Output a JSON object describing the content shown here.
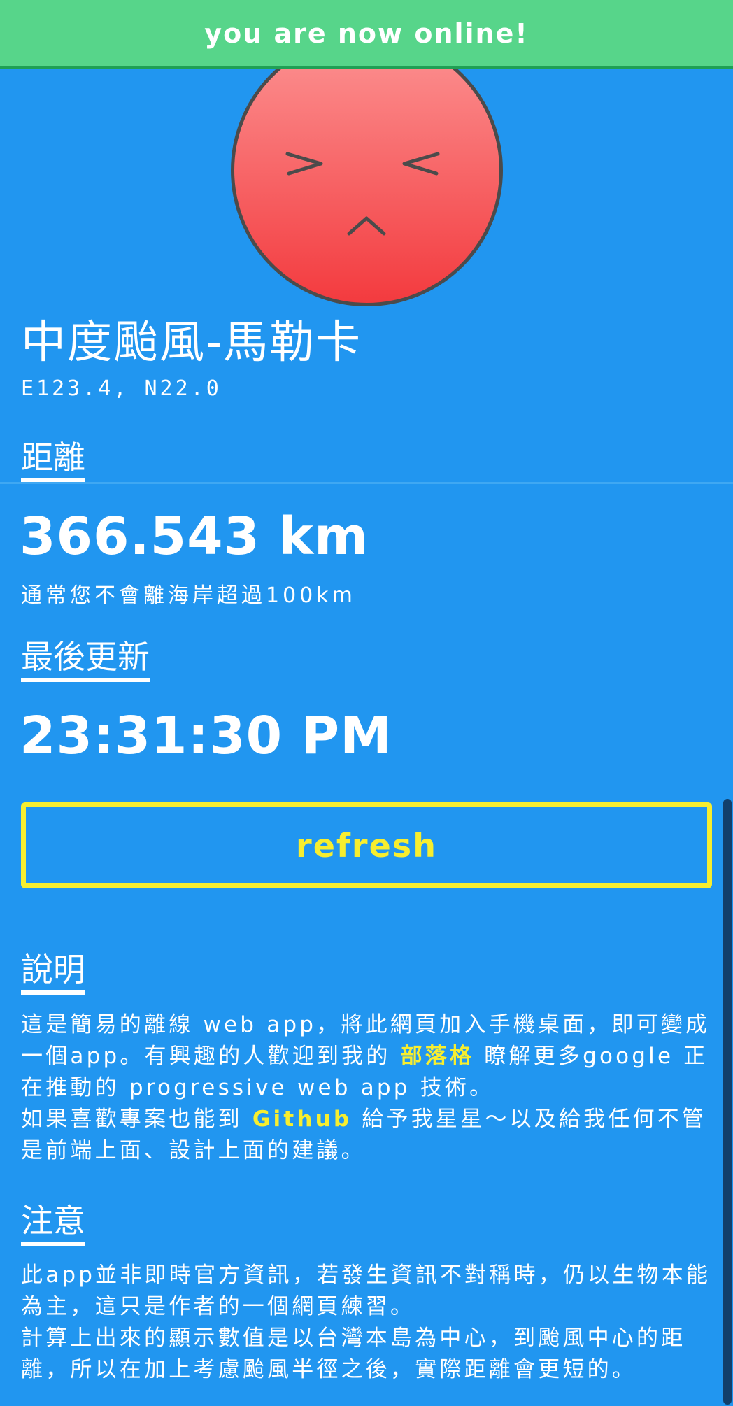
{
  "status_bar": {
    "text": "you are now online!"
  },
  "typhoon": {
    "name": "中度颱風-馬勒卡",
    "coordinates": "E123.4, N22.0"
  },
  "distance_section": {
    "heading": "距離",
    "value": "366.543 km",
    "note": "通常您不會離海岸超過100km"
  },
  "update_section": {
    "heading": "最後更新",
    "value": "23:31:30 PM"
  },
  "refresh_button": {
    "label": "refresh"
  },
  "description_section": {
    "heading": "說明",
    "p1_before": "這是簡易的離線 web app，將此網頁加入手機桌面，即可變成一個app。有興趣的人歡迎到我的 ",
    "blog_link": "部落格",
    "p1_after": " 瞭解更多google 正在推動的 progressive web app 技術。",
    "p2_before": "如果喜歡專案也能到 ",
    "github_link": "Github",
    "p2_after": " 給予我星星～以及給我任何不管是前端上面、設計上面的建議。"
  },
  "notice_section": {
    "heading": "注意",
    "p1": "此app並非即時官方資訊，若發生資訊不對稱時，仍以生物本能為主，這只是作者的一個網頁練習。",
    "p2": "計算上出來的顯示數值是以台灣本島為中心，到颱風中心的距離，所以在加上考慮颱風半徑之後，實際距離會更短的。"
  },
  "colors": {
    "background": "#2196f0",
    "status_bar": "#57d58a",
    "accent_yellow": "#f7ee2f",
    "face_top": "#fc9393",
    "face_bottom": "#f33a3e"
  },
  "icons": {
    "face": "wincing-face-icon"
  }
}
